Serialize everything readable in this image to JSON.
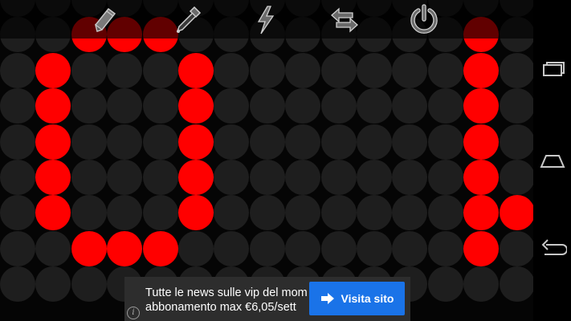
{
  "board": {
    "rows": 9,
    "cols": 15,
    "off_color": "#1e1e1e",
    "on_color": "#ff0000",
    "lit_cells": [
      [
        1,
        2
      ],
      [
        1,
        3
      ],
      [
        1,
        4
      ],
      [
        2,
        1
      ],
      [
        2,
        5
      ],
      [
        3,
        1
      ],
      [
        3,
        5
      ],
      [
        4,
        1
      ],
      [
        4,
        5
      ],
      [
        5,
        1
      ],
      [
        5,
        5
      ],
      [
        6,
        1
      ],
      [
        6,
        5
      ],
      [
        7,
        2
      ],
      [
        7,
        3
      ],
      [
        7,
        4
      ],
      [
        1,
        13
      ],
      [
        2,
        13
      ],
      [
        3,
        13
      ],
      [
        4,
        13
      ],
      [
        5,
        13
      ],
      [
        6,
        13
      ],
      [
        6,
        14
      ],
      [
        7,
        13
      ]
    ]
  },
  "toolbar": {
    "tools": [
      {
        "name": "pencil-icon"
      },
      {
        "name": "dropper-icon"
      },
      {
        "name": "lightning-icon"
      },
      {
        "name": "swap-arrows-icon"
      },
      {
        "name": "power-icon"
      }
    ]
  },
  "navbar": {
    "buttons": [
      {
        "name": "recent-apps-icon"
      },
      {
        "name": "home-icon"
      },
      {
        "name": "back-icon"
      }
    ]
  },
  "ad": {
    "text_line1": "Tutte le news sulle vip del mom",
    "text_line2": "abbonamento max €6,05/sett",
    "button_label": "Visita sito",
    "button_color": "#1a73e8",
    "info_icon": "info-icon"
  }
}
